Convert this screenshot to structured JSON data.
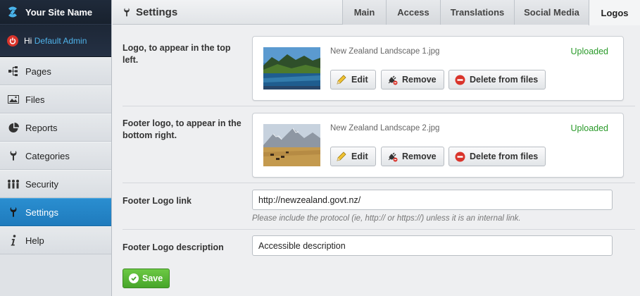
{
  "sidebar": {
    "brand": "Your Site Name",
    "greeting": "Hi",
    "user": "Default Admin",
    "items": [
      {
        "label": "Pages",
        "icon": "sitemap-icon"
      },
      {
        "label": "Files",
        "icon": "image-icon"
      },
      {
        "label": "Reports",
        "icon": "pie-chart-icon"
      },
      {
        "label": "Categories",
        "icon": "wrench-icon"
      },
      {
        "label": "Security",
        "icon": "people-icon"
      },
      {
        "label": "Settings",
        "icon": "wrench-icon",
        "active": true
      },
      {
        "label": "Help",
        "icon": "info-icon"
      }
    ]
  },
  "header": {
    "title": "Settings",
    "tabs": [
      {
        "label": "Main"
      },
      {
        "label": "Access"
      },
      {
        "label": "Translations"
      },
      {
        "label": "Social Media"
      },
      {
        "label": "Logos",
        "active": true
      }
    ]
  },
  "form": {
    "logo": {
      "label": "Logo, to appear in the top left.",
      "filename": "New Zealand Landscape 1.jpg",
      "status": "Uploaded",
      "edit": "Edit",
      "remove": "Remove",
      "delete": "Delete from files"
    },
    "footer_logo": {
      "label": "Footer logo, to appear in the bottom right.",
      "filename": "New Zealand Landscape 2.jpg",
      "status": "Uploaded",
      "edit": "Edit",
      "remove": "Remove",
      "delete": "Delete from files"
    },
    "footer_link": {
      "label": "Footer Logo link",
      "value": "http://newzealand.govt.nz/",
      "hint": "Please include the protocol (ie, http:// or https://) unless it is an internal link."
    },
    "footer_description": {
      "label": "Footer Logo description",
      "value": "Accessible description"
    },
    "save": "Save"
  },
  "colors": {
    "accent": "#2485c8",
    "success": "#2a9a2a",
    "save": "#52b032",
    "danger": "#d9342b"
  }
}
